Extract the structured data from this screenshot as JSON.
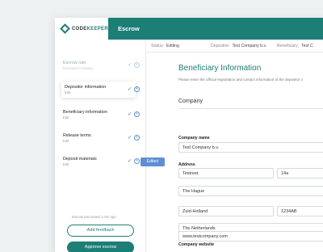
{
  "app": {
    "brand_a": "CODE",
    "brand_b": "KEEPER",
    "title": "Escrow"
  },
  "subbar": {
    "status_label": "Status:",
    "status_value": "Editing",
    "depositor_label": "Depositor:",
    "depositor_value": "Test Company b.v.",
    "beneficiary_label": "Beneficiary:",
    "beneficiary_value": "Test C"
  },
  "sidebar": {
    "steps": [
      {
        "name": "Escrow role",
        "sub": "Escrowed Company"
      },
      {
        "name": "Depositor information",
        "sub": "Edit"
      },
      {
        "name": "Beneficiary information",
        "sub": "Edit"
      },
      {
        "name": "Release terms",
        "sub": "Edit"
      },
      {
        "name": "Deposit materials",
        "sub": "Edit"
      }
    ],
    "edited_tag": "Edited",
    "saved_text": "Escrow last saved 1 min ago",
    "add_feedback": "Add feedback",
    "approve": "Approve escrow"
  },
  "main": {
    "title": "Beneficiary Information",
    "intro": "Please enter the official registration and contact information of the depositor c",
    "section": "Company",
    "company_name_label": "Company name",
    "company_name": "Test Company b.v.",
    "address_label": "Address",
    "street": "Testreet",
    "number": "14a",
    "city": "The Hague",
    "region": "Zuid-Holland",
    "postcode": "1234AB",
    "country": "The Netherlands",
    "website_label": "Company website",
    "website": "www.testcompany.com"
  },
  "colors": {
    "brand": "#1d7e76",
    "accent": "#5d8fd3"
  }
}
